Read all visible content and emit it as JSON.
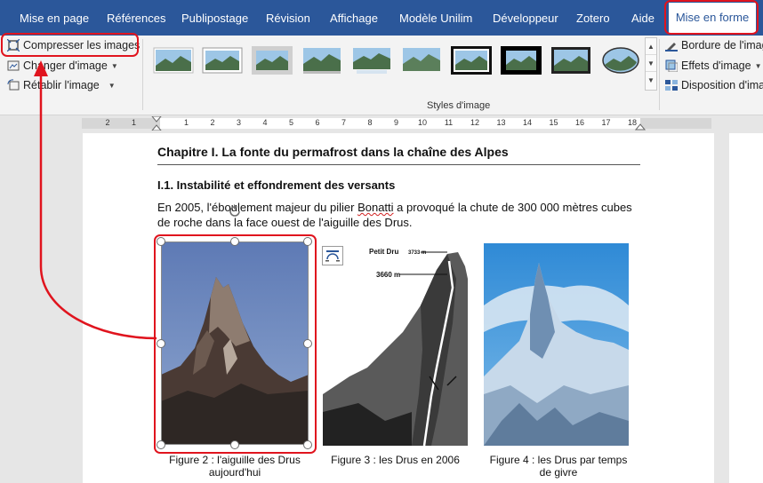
{
  "tabs": [
    {
      "label": "Mise en page"
    },
    {
      "label": "Références"
    },
    {
      "label": "Publipostage"
    },
    {
      "label": "Révision"
    },
    {
      "label": "Affichage"
    },
    {
      "label": "Modèle Unilim"
    },
    {
      "label": "Développeur"
    },
    {
      "label": "Zotero"
    },
    {
      "label": "Aide"
    },
    {
      "label": "Mise en forme"
    }
  ],
  "ribbon": {
    "adjust": {
      "compress": "Compresser les images",
      "change": "Changer d'image",
      "reset": "Rétablir l'image"
    },
    "styles_label": "Styles d'image",
    "right": {
      "border": "Bordure de l'imag",
      "effects": "Effets d'image",
      "layout": "Disposition d'imag"
    }
  },
  "ruler": {
    "left_numbers": [
      "2",
      "1"
    ],
    "numbers": [
      "1",
      "2",
      "3",
      "4",
      "5",
      "6",
      "7",
      "8",
      "9",
      "10",
      "11",
      "12",
      "13",
      "14",
      "15",
      "16",
      "17",
      "18"
    ]
  },
  "document": {
    "chapter_title": "Chapitre I. La fonte du permafrost dans la chaîne des Alpes",
    "section_title": "I.1. Instabilité et effondrement des versants",
    "para_line1_a": "En 2005, l'éboulement majeur du pilier ",
    "para_line1_b": "Bonatti",
    "para_line1_c": " a provoqué la chute de 300 000 mètres cubes",
    "para_line2": "de roche dans la face ouest de l'aiguille des Drus.",
    "figures": [
      {
        "caption": "Figure 2 : l'aiguille des Drus aujourd'hui"
      },
      {
        "caption": "Figure 3 : les Drus en 2006"
      },
      {
        "caption": "Figure 4 : les Drus par temps de givre"
      }
    ],
    "fig3_labels": {
      "peak": "Petit Dru",
      "peak_alt": "3733 m",
      "alt": "3660 m"
    }
  },
  "colors": {
    "ribbon_blue": "#2b579a",
    "highlight_red": "#e0141e"
  }
}
